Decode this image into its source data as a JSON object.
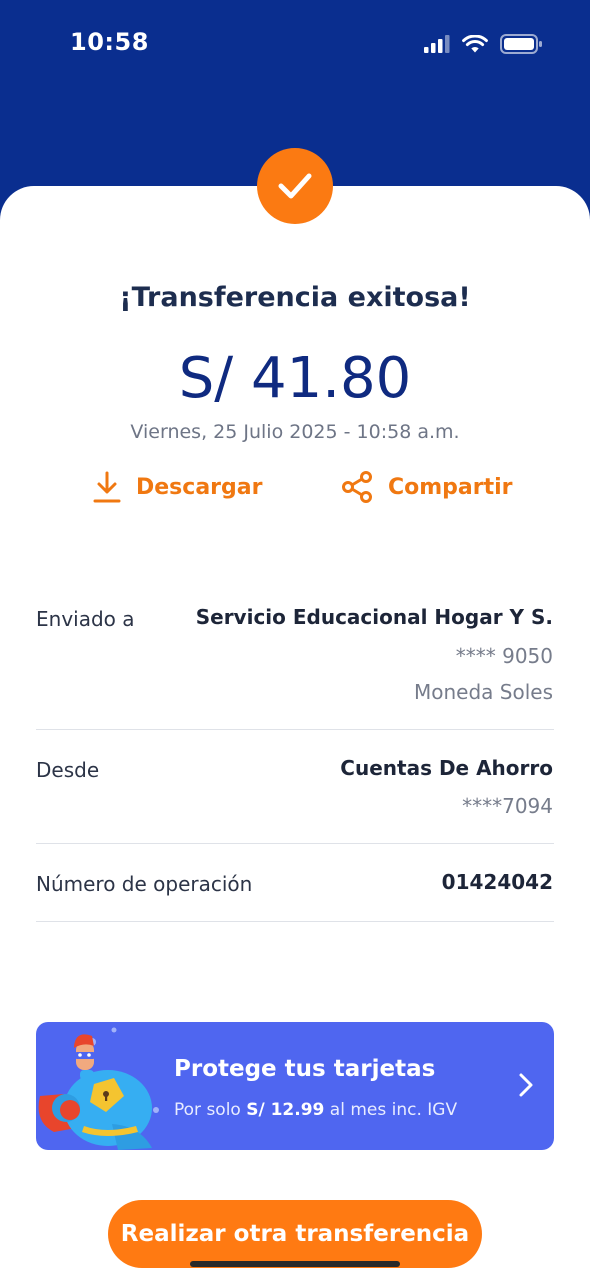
{
  "status_bar": {
    "time": "10:58"
  },
  "result": {
    "title": "¡Transferencia exitosa!",
    "amount": "S/ 41.80",
    "datetime": "Viernes, 25 Julio 2025 - 10:58 a.m."
  },
  "actions": {
    "download": "Descargar",
    "share": "Compartir"
  },
  "details": {
    "sent_to": {
      "label": "Enviado a",
      "name": "Servicio Educacional Hogar Y S.",
      "account": "**** 9050",
      "currency": "Moneda Soles"
    },
    "from": {
      "label": "Desde",
      "account_type": "Cuentas De Ahorro",
      "account": "****7094"
    },
    "operation": {
      "label": "Número de operación",
      "number": "01424042"
    }
  },
  "promo": {
    "title": "Protege tus tarjetas",
    "sub_prefix": "Por solo ",
    "price": "S/ 12.99",
    "sub_suffix": " al mes inc. IGV"
  },
  "cta": {
    "label": "Realizar otra transferencia"
  },
  "colors": {
    "brand_blue": "#0a2e8f",
    "accent_orange": "#fb7a12",
    "promo_blue": "#4f66f0"
  }
}
